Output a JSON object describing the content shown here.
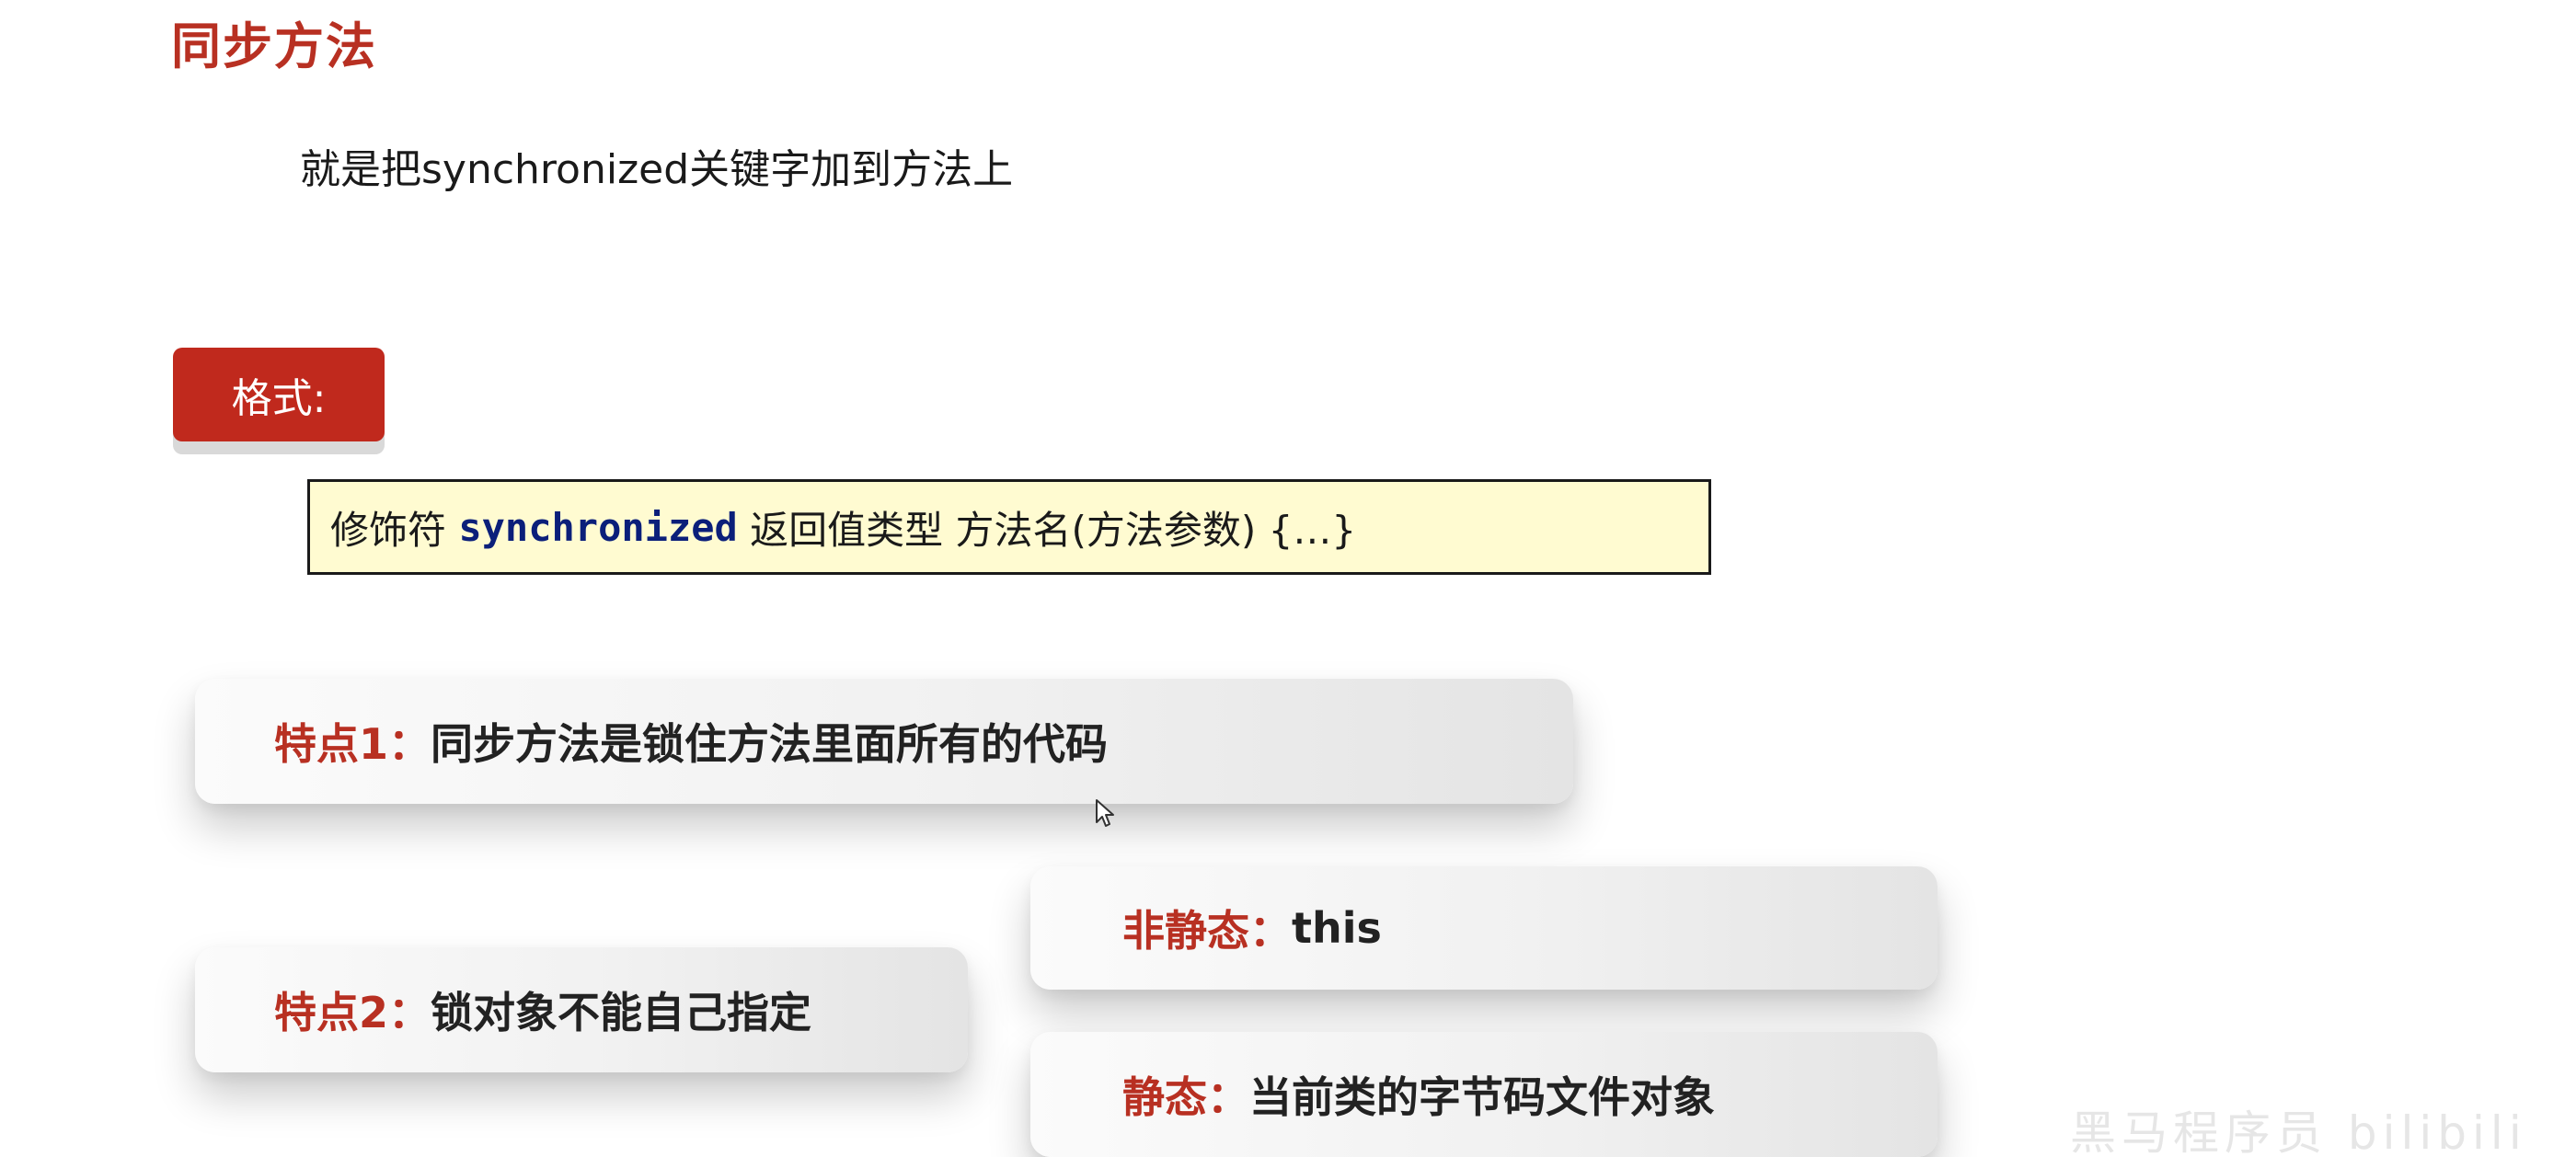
{
  "slide": {
    "title": "同步方法",
    "description": "就是把synchronized关键字加到方法上",
    "format_label": "格式:",
    "code": {
      "prefix": "修饰符 ",
      "keyword": "synchronized",
      "suffix": " 返回值类型 方法名(方法参数) {…}"
    },
    "features": [
      {
        "label": "特点1：",
        "text": "同步方法是锁住方法里面所有的代码"
      },
      {
        "label": "特点2：",
        "text": "锁对象不能自己指定"
      }
    ],
    "lock_objects": [
      {
        "label": "非静态：",
        "text": "this"
      },
      {
        "label": "静态：",
        "text": "当前类的字节码文件对象"
      }
    ],
    "watermark": "黑马程序员 bilibili"
  },
  "colors": {
    "title": "#b83022",
    "accent_red": "#c0291d",
    "code_background": "#fffbd1",
    "keyword_blue": "#0b1f7a"
  },
  "icons": {
    "cursor": "mouse-pointer-icon"
  }
}
